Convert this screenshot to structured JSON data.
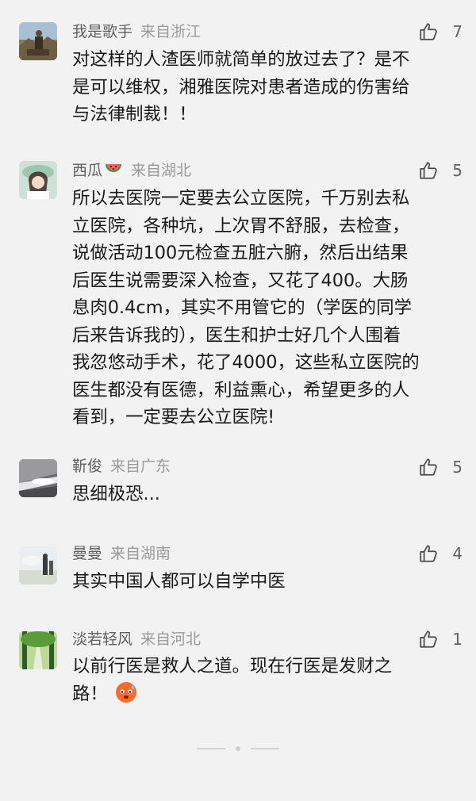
{
  "comments": [
    {
      "username": "我是歌手",
      "location": "来自浙江",
      "likes": "7",
      "text": "对这样的人渣医师就简单的放过去了？是不\n是可以维权，湘雅医院对患者造成的伤害给\n与法律制裁！！"
    },
    {
      "username": "西瓜",
      "location": "来自湖北",
      "likes": "5",
      "text": "所以去医院一定要去公立医院，千万别去私\n立医院，各种坑，上次胃不舒服，去检查，\n说做活动100元检查五脏六腑，然后出结果\n后医生说需要深入检查，又花了400。大肠\n息肉0.4cm，其实不用管它的（学医的同学\n后来告诉我的），医生和护士好几个人围着\n我忽悠动手术，花了4000，这些私立医院的\n医生都没有医德，利益熏心，希望更多的人\n看到，一定要去公立医院!"
    },
    {
      "username": "靳俊",
      "location": "来自广东",
      "likes": "5",
      "text": "思细极恐..."
    },
    {
      "username": "曼曼",
      "location": "来自湖南",
      "likes": "4",
      "text": "其实中国人都可以自学中医"
    },
    {
      "username": "淡若轻风",
      "location": "来自河北",
      "likes": "1",
      "text": "以前行医是救人之道。现在行医是发财之\n路！"
    }
  ],
  "icons": {
    "like": "thumbs-up-icon",
    "username_emoji": "watermelon-icon",
    "tail_emoji": "sweating-face-icon"
  },
  "colors": {
    "background": "#f2f2f2",
    "username": "#5f5f5f",
    "location": "#9a9a9a",
    "body_text": "#1a1a1a"
  }
}
